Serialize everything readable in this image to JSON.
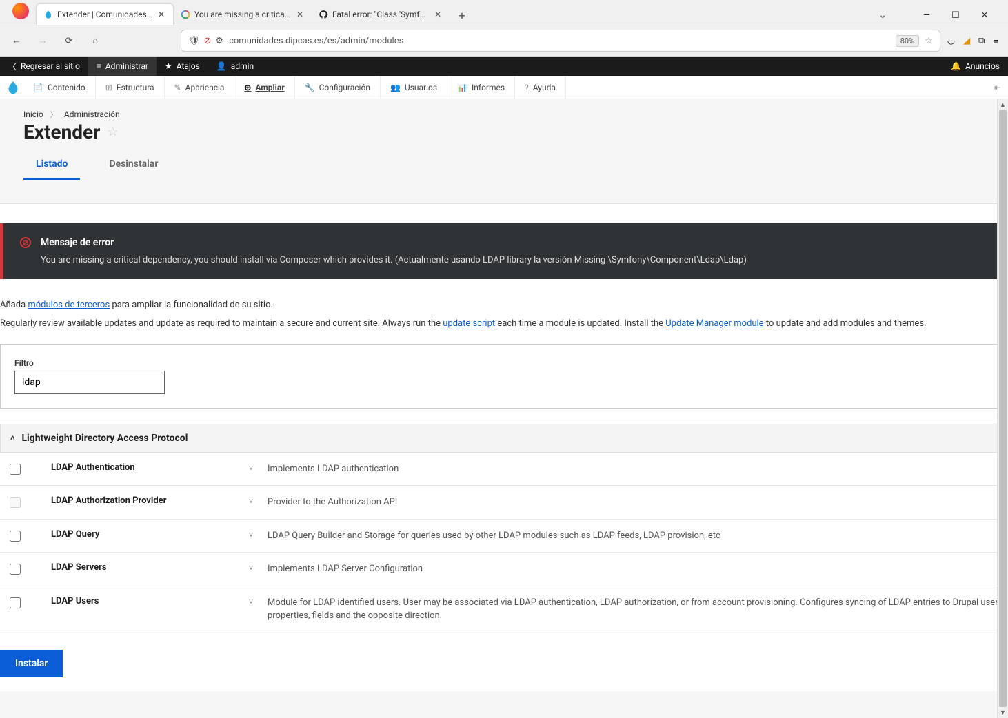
{
  "browser": {
    "tabs": [
      {
        "label": "Extender | Comunidades Dipcas",
        "favicon": "drupal"
      },
      {
        "label": "You are missing a critical depen",
        "favicon": "google"
      },
      {
        "label": "Fatal error: \"Class 'Symfony\\Co",
        "favicon": "github"
      }
    ],
    "url": "comunidades.dipcas.es/es/admin/modules",
    "zoom": "80%"
  },
  "drupal_bar": {
    "back_to_site": "Regresar al sitio",
    "manage": "Administrar",
    "shortcuts": "Atajos",
    "user": "admin",
    "announcements": "Anuncios"
  },
  "admin_menu": [
    {
      "label": "Contenido"
    },
    {
      "label": "Estructura"
    },
    {
      "label": "Apariencia"
    },
    {
      "label": "Ampliar",
      "active": true
    },
    {
      "label": "Configuración"
    },
    {
      "label": "Usuarios"
    },
    {
      "label": "Informes"
    },
    {
      "label": "Ayuda"
    }
  ],
  "breadcrumb": {
    "home": "Inicio",
    "admin": "Administración"
  },
  "page": {
    "title": "Extender",
    "tabs": {
      "list": "Listado",
      "uninstall": "Desinstalar"
    }
  },
  "error": {
    "title": "Mensaje de error",
    "body": "You are missing a critical dependency, you should install via Composer which provides it. (Actualmente usando LDAP library la versión Missing \\Symfony\\Component\\Ldap\\Ldap)"
  },
  "intro": {
    "p1_a": "Añada ",
    "p1_link": "módulos de terceros",
    "p1_b": " para ampliar la funcionalidad de su sitio.",
    "p2_a": "Regularly review available updates and update as required to maintain a secure and current site. Always run the ",
    "p2_link1": "update script",
    "p2_b": " each time a module is updated. Install the ",
    "p2_link2": "Update Manager module",
    "p2_c": " to update and add modules and themes."
  },
  "filter": {
    "label": "Filtro",
    "value": "ldap"
  },
  "section_title": "Lightweight Directory Access Protocol",
  "modules": [
    {
      "name": "LDAP Authentication",
      "desc": "Implements LDAP authentication",
      "disabled": false
    },
    {
      "name": "LDAP Authorization Provider",
      "desc": "Provider to the Authorization API",
      "disabled": true
    },
    {
      "name": "LDAP Query",
      "desc": "LDAP Query Builder and Storage for queries used by other LDAP modules such as LDAP feeds, LDAP provision, etc",
      "disabled": false
    },
    {
      "name": "LDAP Servers",
      "desc": "Implements LDAP Server Configuration",
      "disabled": false
    },
    {
      "name": "LDAP Users",
      "desc": "Module for LDAP identified users. User may be associated via LDAP authentication, LDAP authorization, or from account provisioning. Configures syncing of LDAP entries to Drupal user properties, fields and the opposite direction.",
      "disabled": false
    }
  ],
  "install_label": "Instalar"
}
